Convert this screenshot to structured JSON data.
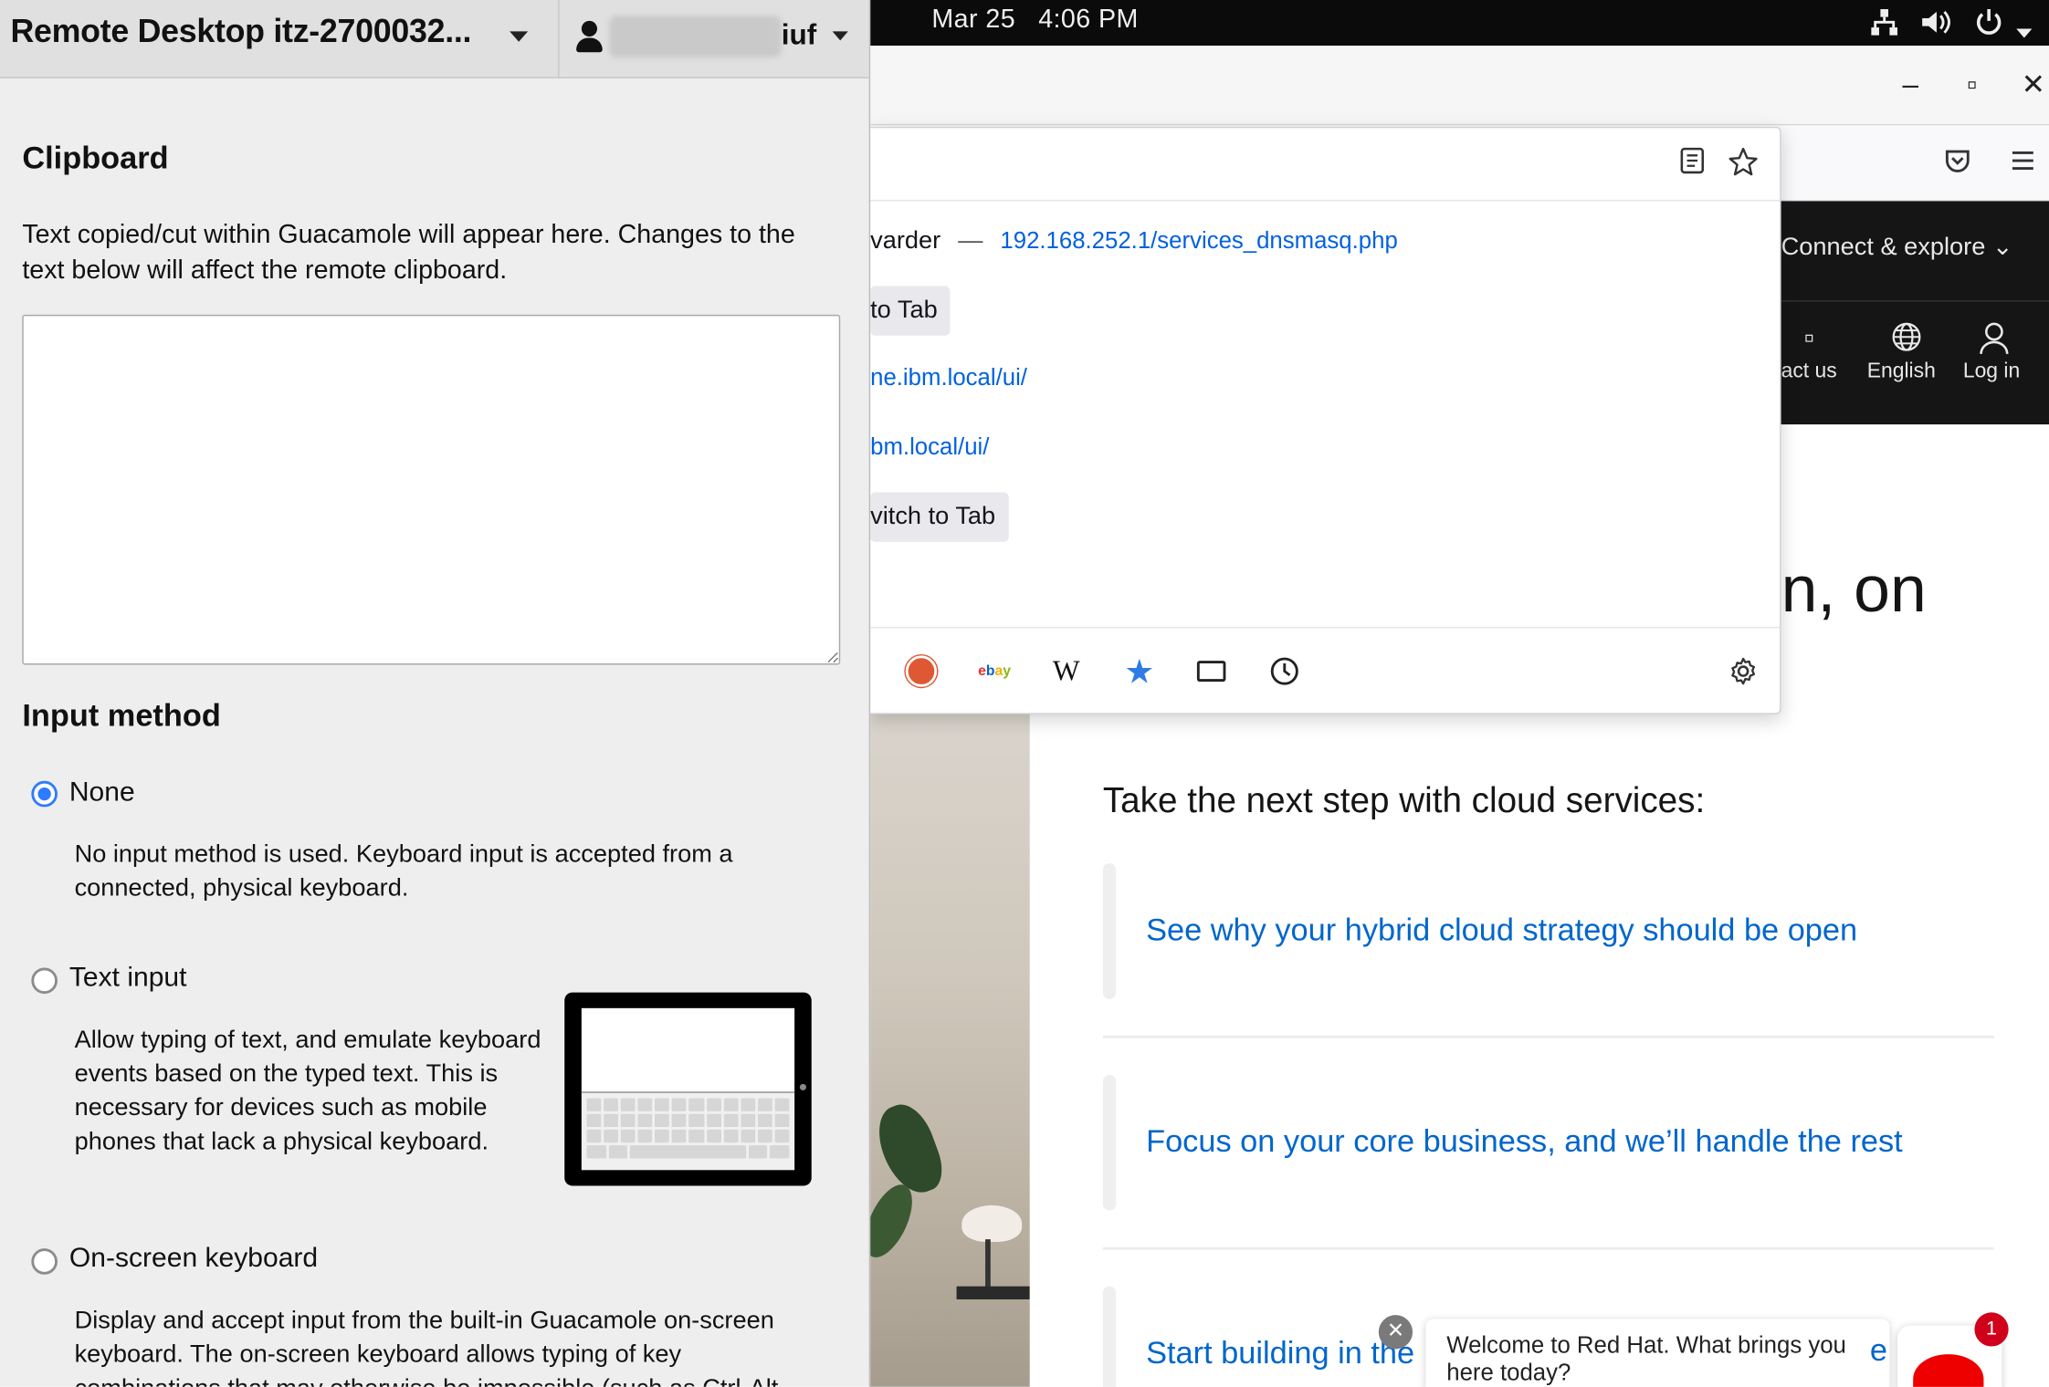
{
  "guacamole": {
    "title": "Remote Desktop itz-2700032...",
    "user_suffix": "iuf",
    "clipboard": {
      "heading": "Clipboard",
      "description": "Text copied/cut within Guacamole will appear here. Changes to the text below will affect the remote clipboard.",
      "value": ""
    },
    "input_method": {
      "heading": "Input method",
      "options": [
        {
          "label": "None",
          "selected": true,
          "description": "No input method is used. Keyboard input is accepted from a connected, physical keyboard."
        },
        {
          "label": "Text input",
          "selected": false,
          "description": "Allow typing of text, and emulate keyboard events based on the typed text. This is necessary for devices such as mobile phones that lack a physical keyboard."
        },
        {
          "label": "On-screen keyboard",
          "selected": false,
          "description": "Display and accept input from the built-in Guacamole on-screen keyboard. The on-screen keyboard allows typing of key combinations that may otherwise be impossible (such as Ctrl-Alt"
        }
      ]
    }
  },
  "gnome_topbar": {
    "date": "Mar 25",
    "time": "4:06 PM",
    "icons": [
      "network-icon",
      "volume-icon",
      "power-icon",
      "menu-caret-icon"
    ]
  },
  "firefox": {
    "window_buttons": {
      "minimize": "–",
      "maximize": "▫",
      "close": "✕"
    },
    "dropdown": {
      "rows": [
        {
          "title": "varder",
          "separator": "—",
          "url": "192.168.252.1/services_dnsmasq.php"
        },
        {
          "button": "to Tab"
        },
        {
          "url": "ne.ibm.local/ui/"
        },
        {
          "url": "bm.local/ui/"
        },
        {
          "button": "vitch to Tab"
        }
      ],
      "search_engines": [
        "DuckDuckGo",
        "ebay",
        "Wikipedia",
        "Bookmarks",
        "Tabs",
        "History"
      ]
    }
  },
  "redhat_page": {
    "nav": {
      "connect": "Connect & explore ⌄",
      "contact": "act us",
      "language": "English",
      "login": "Log in"
    },
    "hero_fragment": "n, on",
    "next_step": "Take the next step with cloud services:",
    "cards": [
      "See why your hybrid cloud strategy should be open",
      "Focus on your core business, and we’ll handle the rest",
      "Start building in the"
    ],
    "chat": {
      "message": "Welcome to Red Hat. What brings you here today?",
      "trailing": "e",
      "badge": "1"
    }
  },
  "colors": {
    "link_blue": "#0066cc",
    "radio_blue": "#2f7bff",
    "redhat_red": "#ee0000",
    "guac_panel": "#eeeeee"
  }
}
